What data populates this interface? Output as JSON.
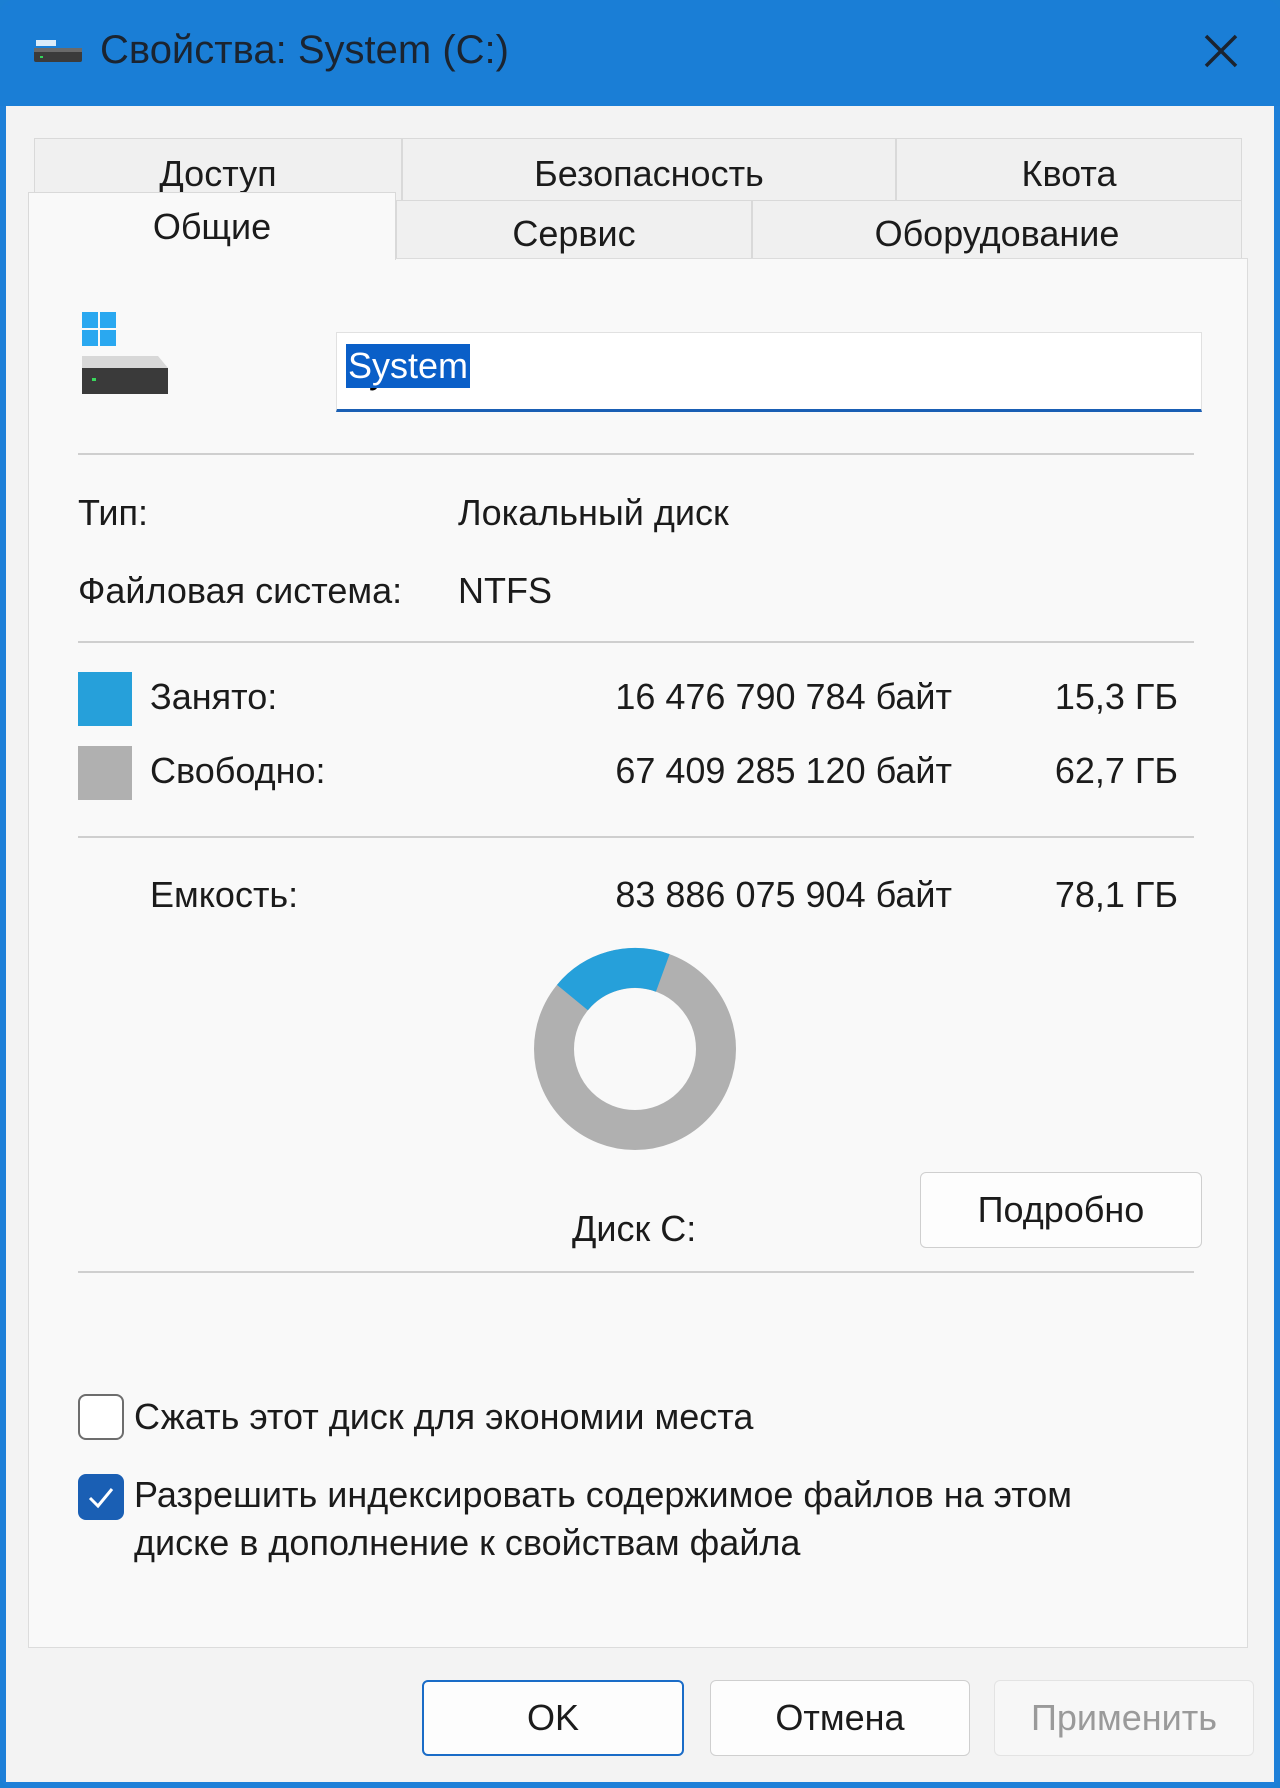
{
  "window": {
    "title": "Свойства: System (C:)"
  },
  "tabs": {
    "row1": [
      {
        "label": "Доступ"
      },
      {
        "label": "Безопасность"
      },
      {
        "label": "Квота"
      }
    ],
    "row2": [
      {
        "label": "Общие",
        "active": true
      },
      {
        "label": "Сервис"
      },
      {
        "label": "Оборудование"
      }
    ]
  },
  "general": {
    "volume_name": "System",
    "type_label": "Тип:",
    "type_value": "Локальный диск",
    "fs_label": "Файловая система:",
    "fs_value": "NTFS",
    "used": {
      "label": "Занято:",
      "bytes": "16 476 790 784 байт",
      "size": "15,3 ГБ",
      "color": "#26a0da"
    },
    "free": {
      "label": "Свободно:",
      "bytes": "67 409 285 120 байт",
      "size": "62,7 ГБ",
      "color": "#b0b0b0"
    },
    "capacity": {
      "label": "Емкость:",
      "bytes": "83 886 075 904 байт",
      "size": "78,1 ГБ"
    },
    "used_fraction": 0.196,
    "drive_label": "Диск C:",
    "details_button": "Подробно",
    "compress_label": "Сжать этот диск для экономии места",
    "compress_checked": false,
    "index_label_line1": "Разрешить индексировать содержимое файлов на этом",
    "index_label_line2": "диске в дополнение к свойствам файла",
    "index_checked": true
  },
  "footer": {
    "ok": "OK",
    "cancel": "Отмена",
    "apply": "Применить"
  },
  "icons": {
    "title": "drive-icon",
    "close": "close-icon",
    "drive": "windows-drive-icon",
    "check": "checkmark-icon"
  }
}
